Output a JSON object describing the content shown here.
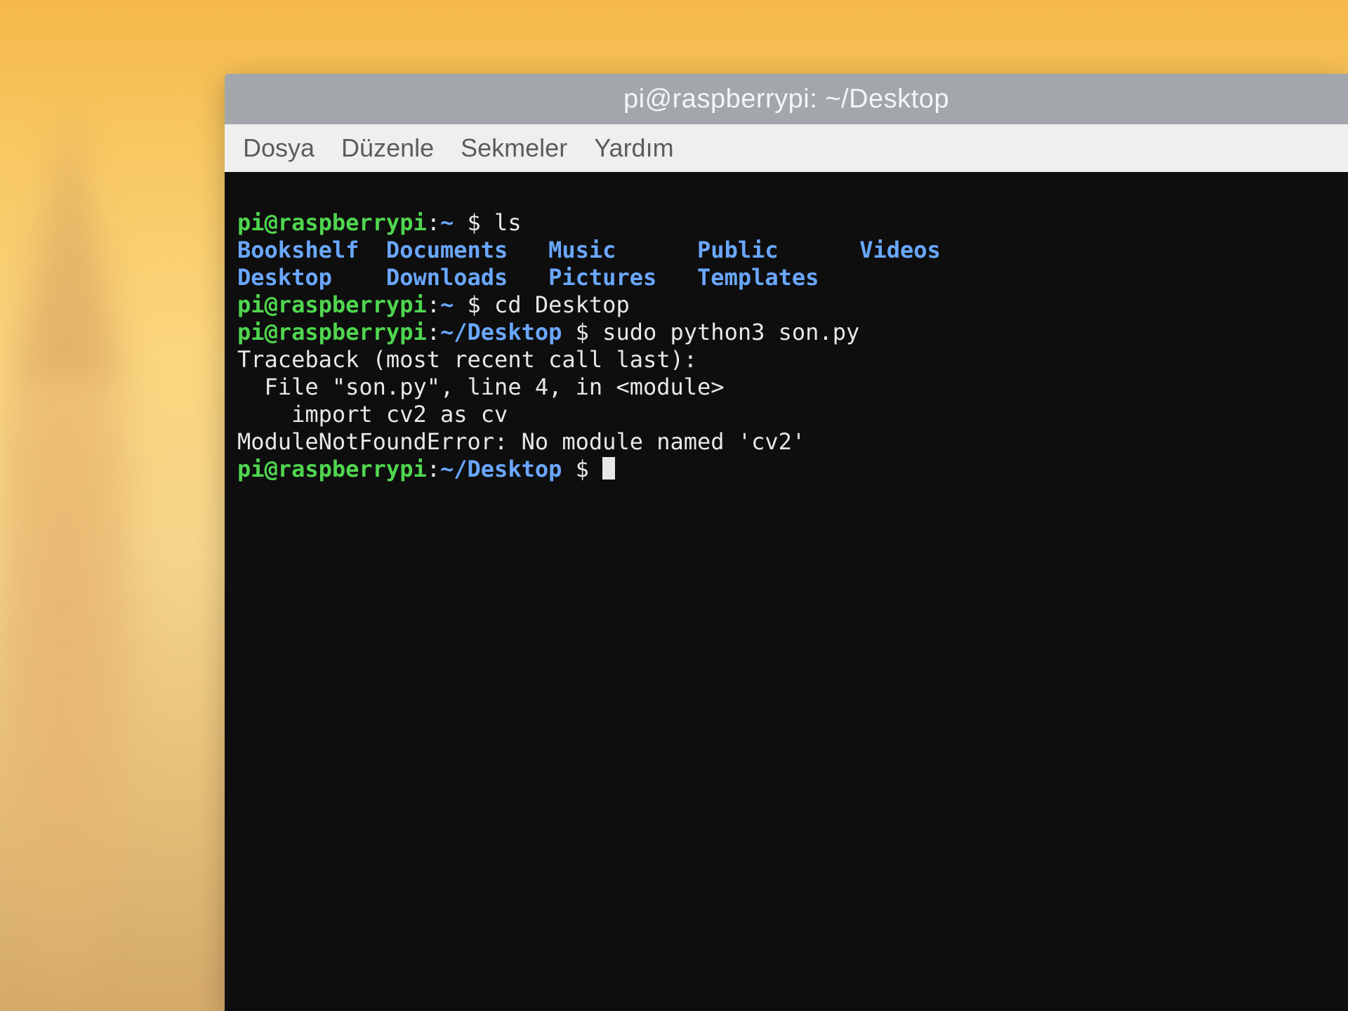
{
  "window": {
    "title": "pi@raspberrypi: ~/Desktop"
  },
  "menubar": {
    "items": [
      "Dosya",
      "Düzenle",
      "Sekmeler",
      "Yardım"
    ]
  },
  "terminal": {
    "prompt1_userhost": "pi@raspberrypi",
    "prompt1_sep": ":",
    "prompt1_path": "~",
    "prompt1_dollar": " $ ",
    "cmd1": "ls",
    "ls_rows": [
      [
        "Bookshelf",
        "Documents",
        "Music",
        "Public",
        "Videos"
      ],
      [
        "Desktop",
        "Downloads",
        "Pictures",
        "Templates",
        ""
      ]
    ],
    "prompt2_userhost": "pi@raspberrypi",
    "prompt2_sep": ":",
    "prompt2_path": "~",
    "prompt2_dollar": " $ ",
    "cmd2": "cd Desktop",
    "prompt3_userhost": "pi@raspberrypi",
    "prompt3_sep": ":",
    "prompt3_path": "~/Desktop",
    "prompt3_dollar": " $ ",
    "cmd3": "sudo python3 son.py",
    "trace1": "Traceback (most recent call last):",
    "trace2": "  File \"son.py\", line 4, in <module>",
    "trace3": "    import cv2 as cv",
    "trace4": "ModuleNotFoundError: No module named 'cv2'",
    "prompt4_userhost": "pi@raspberrypi",
    "prompt4_sep": ":",
    "prompt4_path": "~/Desktop",
    "prompt4_dollar": " $ "
  }
}
